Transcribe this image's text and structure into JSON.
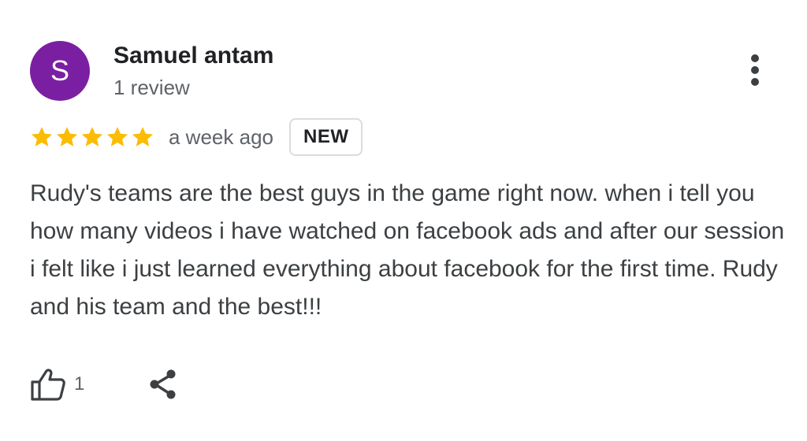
{
  "review": {
    "avatar_letter": "S",
    "avatar_color": "#7b1fa2",
    "user_name": "Samuel antam",
    "review_count": "1 review",
    "rating": 5,
    "rating_max": 5,
    "star_color": "#fbbc04",
    "time_ago": "a week ago",
    "badge": "NEW",
    "text": "Rudy's teams are the best guys in the game right now. when i tell you how many videos i have watched on facebook ads and after our session i felt like i just learned everything about facebook for the first time. Rudy and his team and the best!!!",
    "like_count": "1"
  },
  "icons": {
    "more": "more-vertical-icon",
    "like": "thumbs-up-icon",
    "share": "share-icon",
    "star": "star-icon"
  }
}
